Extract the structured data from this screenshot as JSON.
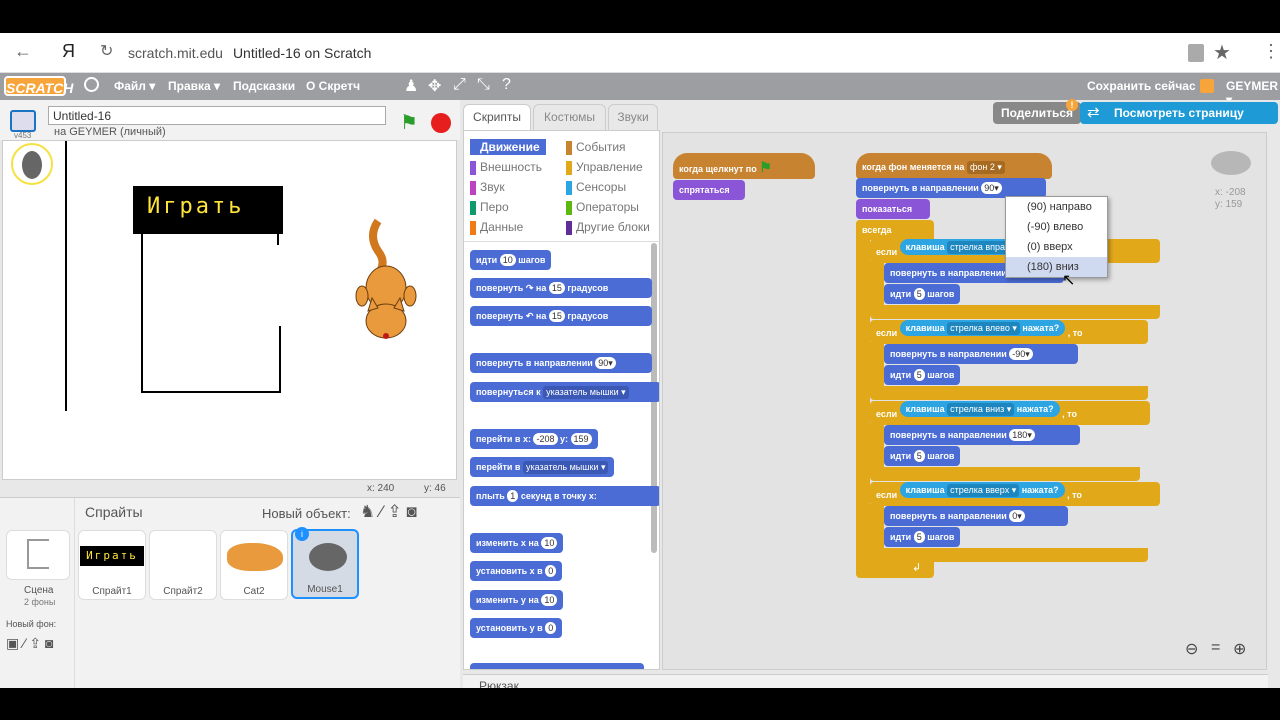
{
  "browser": {
    "url_host": "scratch.mit.edu",
    "page_title": "Untitled-16 on Scratch",
    "yandex": "Я"
  },
  "menu": {
    "logo": "SCRATCH",
    "file": "Файл ▾",
    "edit": "Правка ▾",
    "tips": "Подсказки",
    "about": "О Скретч",
    "save_now": "Сохранить сейчас",
    "user": "GEYMER ▾"
  },
  "stage_header": {
    "title_value": "Untitled-16",
    "owner": "на GEYMER (личный)",
    "version": "v453"
  },
  "stage": {
    "play_text": "Играть",
    "xcoord": "x: 240",
    "ycoord": "y: 46"
  },
  "sprites_panel": {
    "header": "Спрайты",
    "new_object": "Новый объект:",
    "scene_label": "Сцена",
    "scene_sub": "2 фоны",
    "new_bg": "Новый фон:",
    "sprites": [
      "Спрайт1",
      "Спрайт2",
      "Cat2",
      "Mouse1"
    ]
  },
  "tabs": {
    "scripts": "Скрипты",
    "costumes": "Костюмы",
    "sounds": "Звуки"
  },
  "categories": {
    "left": [
      "Движение",
      "Внешность",
      "Звук",
      "Перо",
      "Данные"
    ],
    "right": [
      "События",
      "Управление",
      "Сенсоры",
      "Операторы",
      "Другие блоки"
    ]
  },
  "palette": {
    "move": "идти",
    "move_val": "10",
    "steps": "шагов",
    "turn": "повернуть",
    "on": "на",
    "turn_val": "15",
    "degrees": "градусов",
    "point_dir": "повернуть в направлении",
    "point_val": "90▾",
    "point_toward": "повернуться к",
    "mouse_ptr": "указатель мышки ▾",
    "goto_xy": "перейти в x:",
    "gx": "-208",
    "gy_label": "y:",
    "gy": "159",
    "goto": "перейти в",
    "glide": "плыть",
    "glide_val": "1",
    "glide_rest": "секунд в точку x:",
    "change_x": "изменить х на",
    "change_x_val": "10",
    "set_x": "установить х в",
    "set_x_val": "0",
    "change_y": "изменить у на",
    "change_y_val": "10",
    "set_y": "установить у в",
    "set_y_val": "0"
  },
  "topright": {
    "share": "Поделиться",
    "see_page": "Посмотреть страницу проекта"
  },
  "scripts": {
    "when_flag": "когда щелкнут по",
    "hide": "спрятаться",
    "when_backdrop": "когда фон меняется на",
    "backdrop_val": "фон 2 ▾",
    "point_dir": "повернуть в направлении",
    "val90": "90▾",
    "show": "показаться",
    "forever": "всегда",
    "if": "если",
    "key": "клавиша",
    "then": ", то",
    "pressed": "нажата?",
    "right_key": "стрелка вправо ▾",
    "left_key": "стрелка влево ▾",
    "down_key": "стрелка вниз ▾",
    "up_key": "стрелка вверх ▾",
    "val_neg90": "-90▾",
    "val180": "180▾",
    "val0": "0▾",
    "go": "идти",
    "five": "5",
    "steps": "шагов"
  },
  "dropdown": [
    "(90) направо",
    "(-90) влево",
    "(0) вверх",
    "(180) вниз"
  ],
  "sprite_info": {
    "x": "x: -208",
    "y": "y: 159"
  },
  "backpack": "Рюкзак"
}
